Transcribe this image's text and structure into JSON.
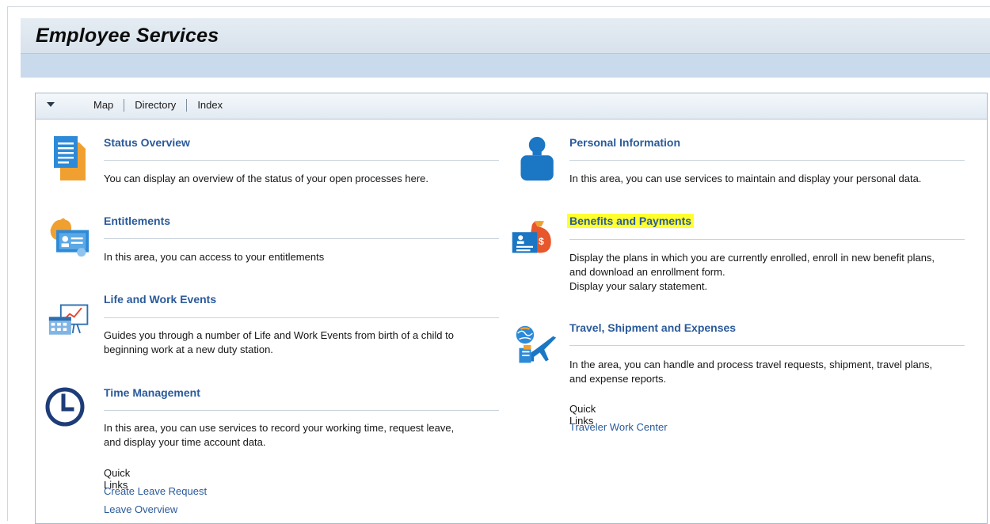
{
  "page": {
    "title": "Employee Services"
  },
  "toolbar": {
    "tabs": [
      {
        "label": "Map"
      },
      {
        "label": "Directory"
      },
      {
        "label": "Index"
      }
    ]
  },
  "sections": {
    "status_overview": {
      "title": "Status Overview",
      "description": "You can display an overview of the status of your open processes here.",
      "icon": "document-icon"
    },
    "entitlements": {
      "title": "Entitlements",
      "description": "In this area, you can access to your entitlements",
      "icon": "certificate-icon"
    },
    "life_work_events": {
      "title": "Life and Work Events",
      "description_line1": "Guides you through a number of Life and Work Events from birth of a child to",
      "description_line2": "beginning work at a new duty station.",
      "icon": "calendar-chart-icon"
    },
    "time_management": {
      "title": "Time Management",
      "description_line1": "In this area, you can use services to record your working time, request leave,",
      "description_line2": "and display your time account data.",
      "quick_links_label": "Quick Links",
      "quick_links": [
        "Create Leave Request",
        "Leave Overview"
      ],
      "icon": "clock-icon"
    },
    "personal_information": {
      "title": "Personal Information",
      "description": "In this area, you can use services to maintain and display your personal data.",
      "icon": "person-icon"
    },
    "benefits_payments": {
      "title": "Benefits and Payments",
      "description_line1": "Display the plans in which you are currently enrolled, enroll in new benefit plans,",
      "description_line2": "and download an enrollment form.",
      "description_line3": "Display your salary statement.",
      "highlight_color": "#ffff2e",
      "icon": "money-card-icon"
    },
    "travel": {
      "title": "Travel, Shipment and Expenses",
      "description_line1": "In the area, you can handle and process travel requests, shipment, travel plans,",
      "description_line2": "and expense reports.",
      "quick_links_label": "Quick Links",
      "quick_links": [
        "Traveler Work Center"
      ],
      "icon": "globe-plane-icon"
    }
  },
  "colors": {
    "link": "#2a5a9a",
    "header_band": "#c9daec",
    "icon_blue": "#1b76c4",
    "icon_orange": "#f0a030"
  }
}
